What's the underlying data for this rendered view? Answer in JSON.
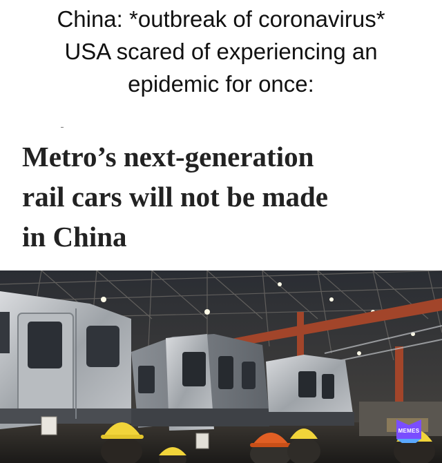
{
  "meme": {
    "caption_lines": [
      "China: *outbreak of coronavirus*",
      "USA scared of experiencing an",
      "epidemic for once:"
    ]
  },
  "article": {
    "headline_lines": [
      "Metro’s next-generation",
      "rail cars will not be made",
      "in China"
    ]
  },
  "watermark": {
    "label": "MEMES",
    "color": "#7a4dff"
  },
  "photo": {
    "subject": "rail-cars-factory"
  }
}
